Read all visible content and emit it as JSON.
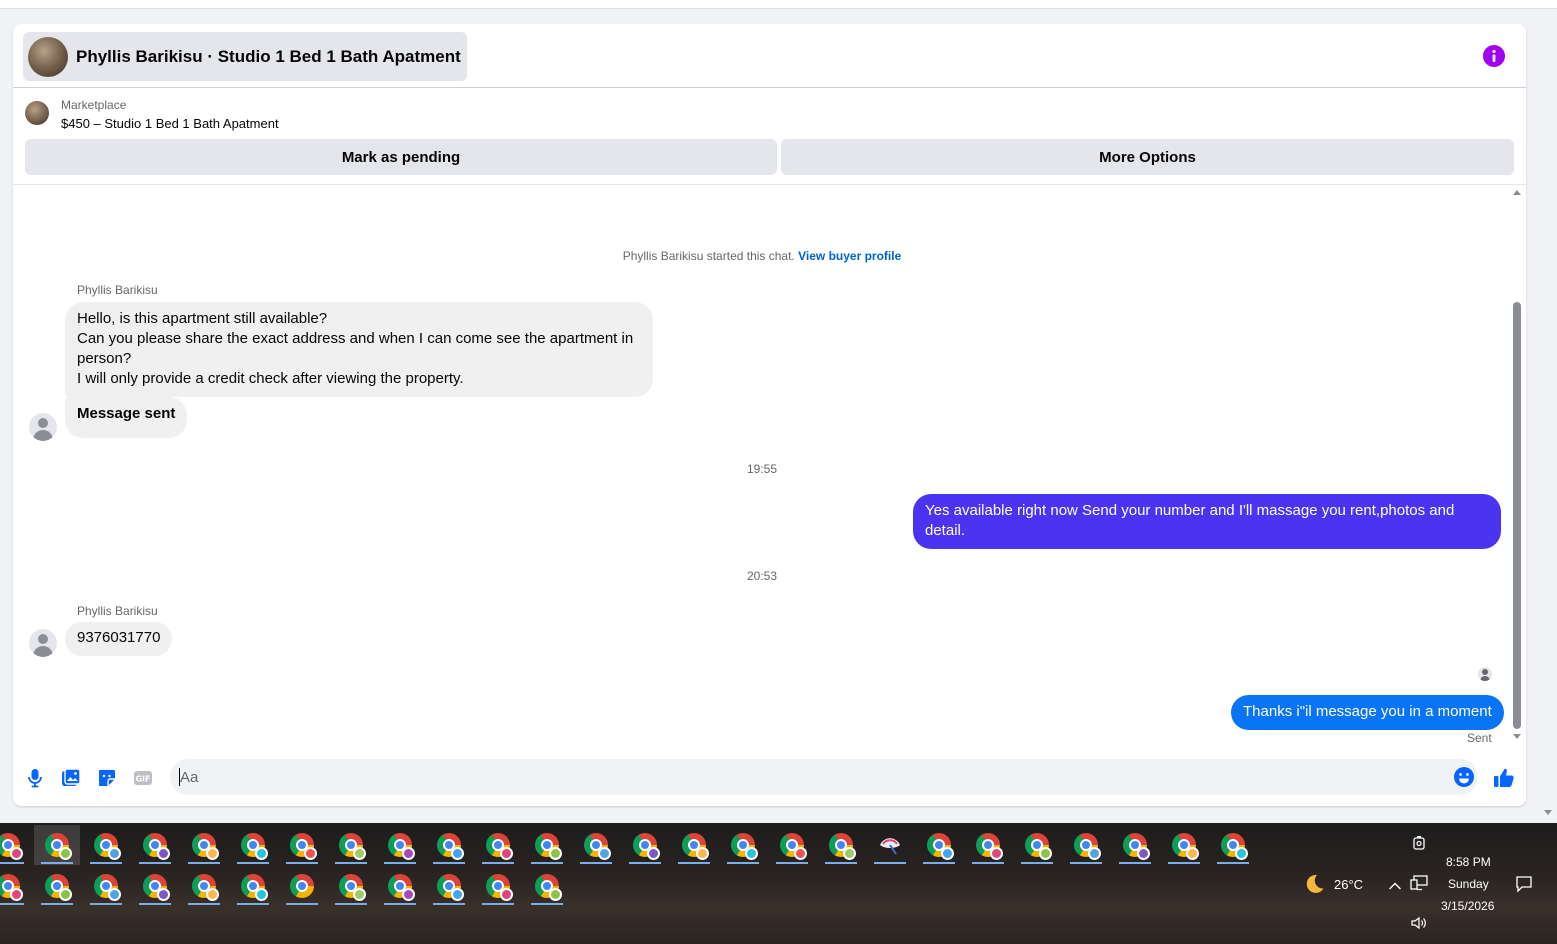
{
  "header": {
    "title": "Phyllis Barikisu · Studio 1 Bed 1 Bath Apatment",
    "info_icon": "info-icon"
  },
  "listing": {
    "label": "Marketplace",
    "title": "$450 – Studio 1 Bed 1 Bath Apatment",
    "buttons": {
      "mark_pending": "Mark as pending",
      "more_options": "More Options"
    }
  },
  "chat": {
    "system_text": "Phyllis Barikisu started this chat.",
    "system_link": "View buyer profile",
    "messages": [
      {
        "sender": "Phyllis Barikisu",
        "direction": "in",
        "lines": [
          "Hello, is this apartment still available?",
          "Can you please share the exact address and when I can come see the apartment in person?",
          "I will only provide a credit check after viewing the property."
        ]
      },
      {
        "direction": "in",
        "text": "Message sent"
      },
      {
        "timestamp": "19:55"
      },
      {
        "direction": "out",
        "text": "Yes available right now Send your number and I'll massage you rent,photos and detail."
      },
      {
        "timestamp": "20:53"
      },
      {
        "sender": "Phyllis Barikisu",
        "direction": "in",
        "text": "9376031770"
      },
      {
        "direction": "out",
        "text": "Thanks i\"il message you in a moment",
        "status": "Sent"
      }
    ]
  },
  "composer": {
    "placeholder": "Aa",
    "tools": [
      "microphone-icon",
      "photo-icon",
      "sticker-icon",
      "gif-icon"
    ],
    "emoji_icon": "emoji-icon",
    "like_icon": "thumbs-up-icon"
  },
  "colors": {
    "accent_outgoing_1": "#4a34f2",
    "accent_outgoing_2": "#0a74f7",
    "info": "#a100f2",
    "incoming_bubble": "#f0f0f0"
  },
  "taskbar": {
    "weather_icon": "moon-icon",
    "temperature": "26°C",
    "time": "8:58 PM",
    "day": "Sunday",
    "date": "3/15/2026",
    "tray_icons": [
      "chevron-up-icon",
      "network-icon",
      "volume-icon",
      "camera-icon",
      "notification-icon"
    ],
    "row1_icons": [
      "chrome-profile-icon",
      "chrome-profile-icon",
      "chrome-profile-icon",
      "chrome-profile-icon",
      "chrome-profile-icon",
      "chrome-profile-icon",
      "chrome-profile-icon",
      "chrome-profile-icon",
      "chrome-profile-icon",
      "chrome-profile-icon",
      "chrome-profile-icon",
      "chrome-profile-icon",
      "chrome-profile-icon",
      "chrome-profile-icon",
      "chrome-profile-icon",
      "chrome-profile-icon",
      "chrome-profile-icon",
      "chrome-profile-icon",
      "app-icon",
      "chrome-profile-icon",
      "chrome-profile-icon",
      "chrome-profile-icon",
      "chrome-profile-icon",
      "chrome-profile-icon",
      "chrome-profile-icon",
      "chrome-profile-icon"
    ],
    "row2_icons": [
      "chrome-profile-icon",
      "chrome-profile-icon",
      "chrome-profile-icon",
      "chrome-profile-icon",
      "chrome-profile-icon",
      "chrome-profile-icon",
      "chrome-icon",
      "chrome-profile-icon",
      "chrome-profile-icon",
      "chrome-profile-icon",
      "chrome-profile-icon",
      "chrome-profile-icon"
    ]
  }
}
